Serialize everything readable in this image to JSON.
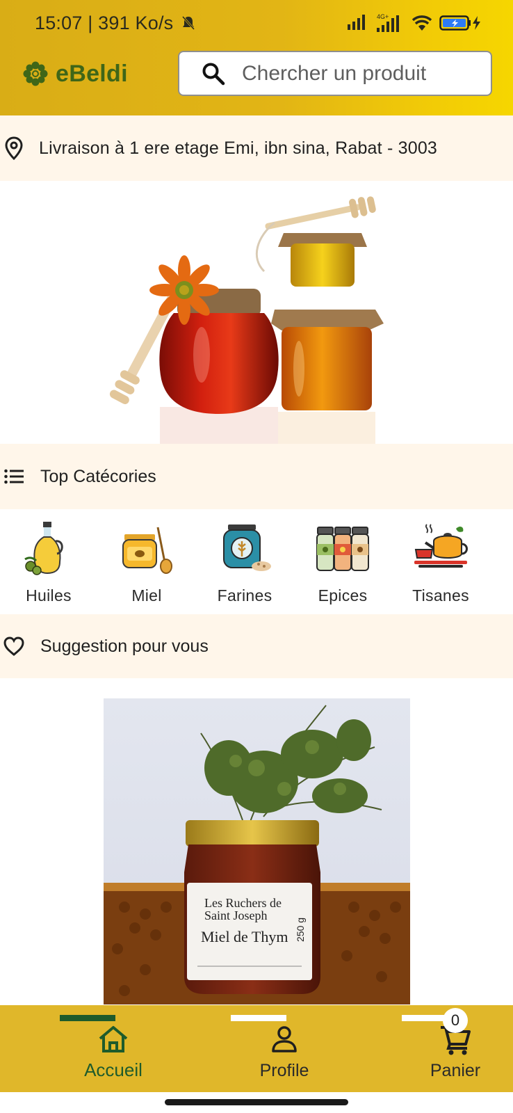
{
  "status_bar": {
    "time": "15:07 | 391 Ko/s",
    "icons": [
      "bell-muted-icon",
      "signal-icon",
      "4g-signal-icon",
      "wifi-icon",
      "battery-charging-icon",
      "charging-bolt-icon"
    ],
    "network_label": "4G+"
  },
  "header": {
    "brand_name": "eBeldi",
    "logo_icon": "flower-logo-icon",
    "search_placeholder": "Chercher un produit"
  },
  "delivery": {
    "icon": "location-pin-icon",
    "text": "Livraison à 1 ere etage Emi, ibn sina, Rabat - 3003"
  },
  "hero": {
    "image": "honey-jars-illustration"
  },
  "top_categories": {
    "icon": "list-icon",
    "title": "Top Catécories",
    "items": [
      {
        "label": "Huiles",
        "icon": "oil-bottle-icon"
      },
      {
        "label": "Miel",
        "icon": "honey-jar-icon"
      },
      {
        "label": "Farines",
        "icon": "flour-jar-icon"
      },
      {
        "label": "Epices",
        "icon": "spice-jars-icon"
      },
      {
        "label": "Tisanes",
        "icon": "teapot-icon"
      }
    ]
  },
  "suggestions": {
    "icon": "heart-icon",
    "title": "Suggestion pour vous",
    "product": {
      "image": "miel-de-thym-jar",
      "brand_label": "Les Ruchers de Saint Joseph",
      "product_label": "Miel de Thym",
      "weight_label": "250 g"
    }
  },
  "bottom_nav": {
    "items": [
      {
        "label": "Accueil",
        "icon": "home-icon",
        "active": true
      },
      {
        "label": "Profile",
        "icon": "user-icon",
        "active": false
      },
      {
        "label": "Panier",
        "icon": "cart-icon",
        "active": false,
        "badge": "0"
      }
    ]
  },
  "colors": {
    "header_yellow": "#e2b515",
    "brand_green": "#3f6618",
    "section_bg": "#fff6ea",
    "nav_bg": "#e0b72a",
    "nav_active": "#1e5b2b"
  }
}
